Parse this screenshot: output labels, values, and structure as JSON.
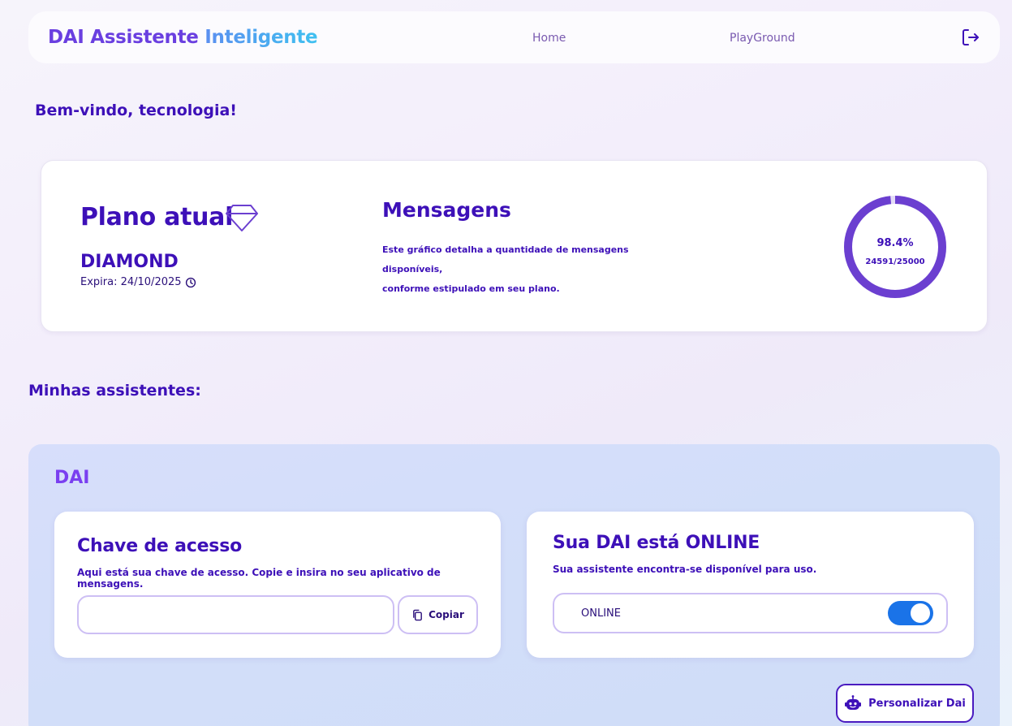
{
  "header": {
    "brand_part1": "DAI Assistente",
    "brand_part2": "Inteligente",
    "nav": [
      {
        "label": "Home"
      },
      {
        "label": "PlayGround"
      }
    ],
    "logout_icon": "logout-icon"
  },
  "welcome": "Bem-vindo, tecnologia!",
  "plan": {
    "title": "Plano atual",
    "icon": "diamond-icon",
    "name": "DIAMOND",
    "expires": "Expira: 24/10/2025",
    "expires_icon": "clock-icon"
  },
  "messages": {
    "title": "Mensagens",
    "description_line1": "Este gráfico detalha a quantidade de mensagens disponíveis,",
    "description_line2": "conforme estipulado em seu plano.",
    "percent_label": "98.4%",
    "count_label": "24591/25000",
    "used": 24591,
    "total": 25000,
    "fraction": 0.984
  },
  "assistants": {
    "section_title": "Minhas assistentes:",
    "items": [
      {
        "name": "DAI",
        "key_card": {
          "title": "Chave de acesso",
          "description": "Aqui está sua chave de acesso. Copie e insira no seu aplicativo de mensagens.",
          "input_value": "",
          "copy_label": "Copiar"
        },
        "status_card": {
          "title": "Sua DAI está ONLINE",
          "description": "Sua assistente encontra-se disponível para uso.",
          "status_label": "ONLINE",
          "toggle_on": true
        },
        "personalize_label": "Personalizar Dai"
      }
    ]
  },
  "colors": {
    "primary": "#3d10b8",
    "accent": "#7a3ff0",
    "ring": "#6b3fd0",
    "toggle": "#1a73e8"
  }
}
